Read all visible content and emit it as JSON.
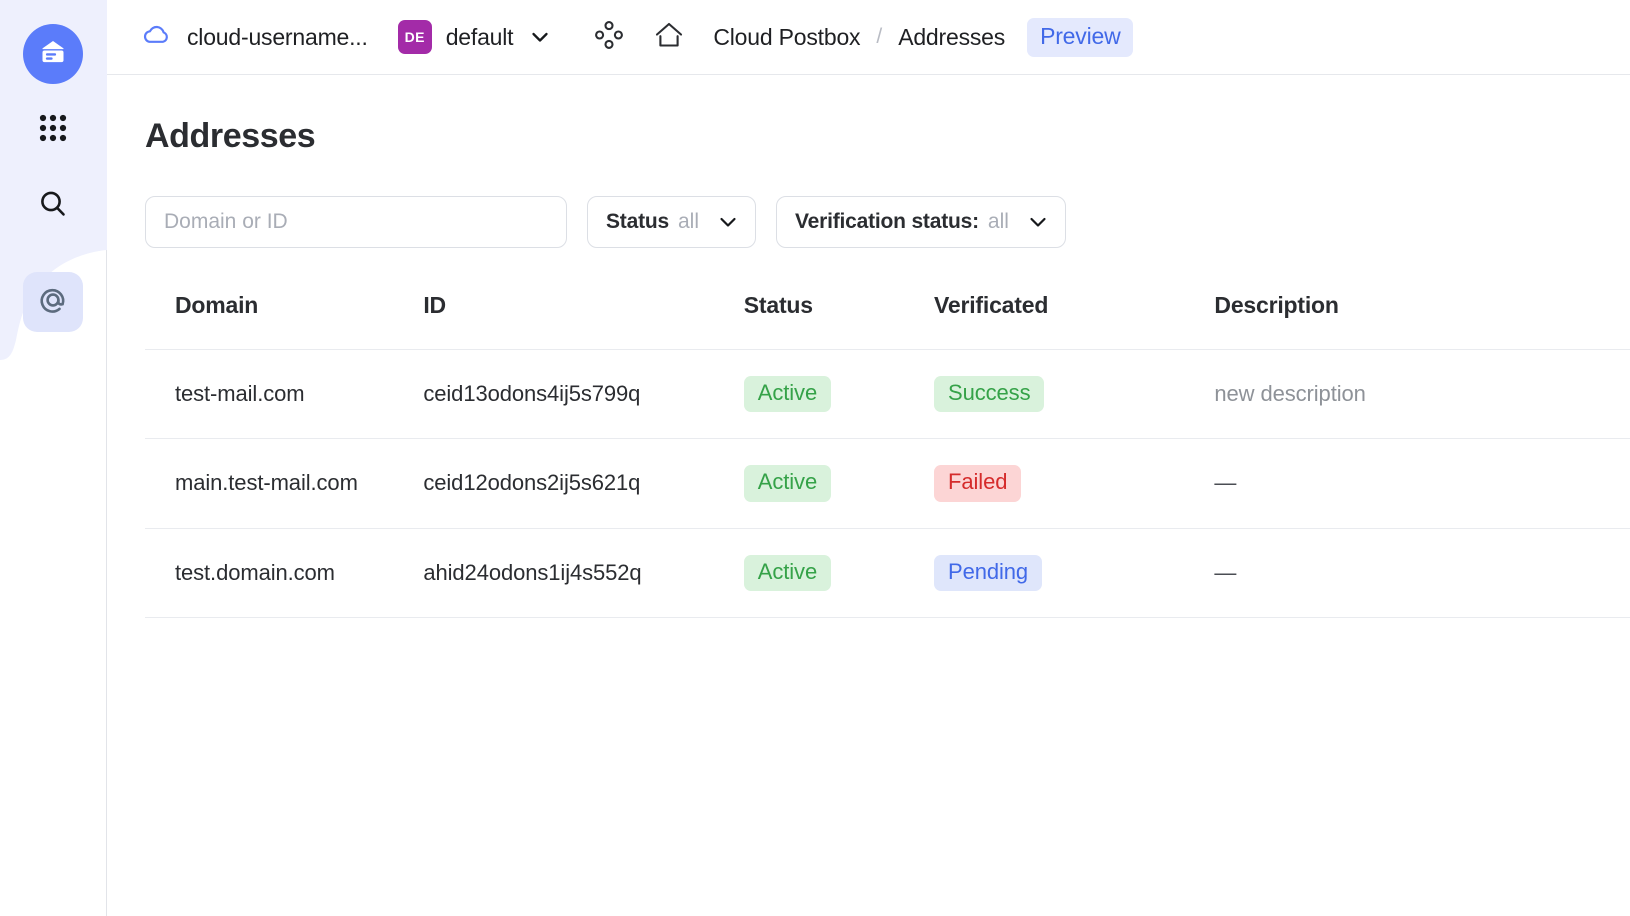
{
  "sidebar": {
    "items": [
      {
        "name": "logo",
        "icon": "mailbox-icon",
        "active": false
      },
      {
        "name": "apps",
        "icon": "grid-dots-icon",
        "active": false
      },
      {
        "name": "search",
        "icon": "search-icon",
        "active": false
      },
      {
        "name": "addresses",
        "icon": "at-sign-icon",
        "active": true
      }
    ]
  },
  "topbar": {
    "cloud_icon": "cloud-icon",
    "cloud_label": "cloud-username...",
    "folder_badge": "DE",
    "folder_label": "default",
    "folder_chevron": "chevron-down-icon",
    "services_icon": "services-icon",
    "home_icon": "home-icon",
    "breadcrumbs": [
      {
        "label": "Cloud Postbox"
      },
      {
        "label": "Addresses"
      }
    ],
    "breadcrumb_separator": "/",
    "preview_label": "Preview"
  },
  "page": {
    "title": "Addresses"
  },
  "filters": {
    "search": {
      "placeholder": "Domain or ID",
      "value": ""
    },
    "status": {
      "label": "Status",
      "value": "all",
      "chevron": "chevron-down-icon"
    },
    "verification_status": {
      "label": "Verification status:",
      "value": "all",
      "chevron": "chevron-down-icon"
    }
  },
  "table": {
    "columns": [
      "Domain",
      "ID",
      "Status",
      "Verificated",
      "Description"
    ],
    "rows": [
      {
        "domain": "test-mail.com",
        "id": "ceid13odons4ij5s799q",
        "status": "Active",
        "status_kind": "active",
        "verificated": "Success",
        "verificated_kind": "success",
        "description": "new description",
        "description_muted": true
      },
      {
        "domain": "main.test-mail.com",
        "id": "ceid12odons2ij5s621q",
        "status": "Active",
        "status_kind": "active",
        "verificated": "Failed",
        "verificated_kind": "failed",
        "description": "—",
        "description_muted": false
      },
      {
        "domain": "test.domain.com",
        "id": "ahid24odons1ij4s552q",
        "status": "Active",
        "status_kind": "active",
        "verificated": "Pending",
        "verificated_kind": "pending",
        "description": "—",
        "description_muted": false
      }
    ]
  },
  "colors": {
    "accent_blue": "#5b7cfa",
    "link_blue": "#4169e8",
    "badge_green_bg": "#d9f2dc",
    "badge_green_fg": "#35a248",
    "badge_red_bg": "#fcd5d5",
    "badge_red_fg": "#d52b2b",
    "badge_blue_bg": "#dfe6fb",
    "badge_blue_fg": "#4169e8",
    "de_badge": "#a32ba8",
    "sidebar_tint": "#eef0fd"
  }
}
